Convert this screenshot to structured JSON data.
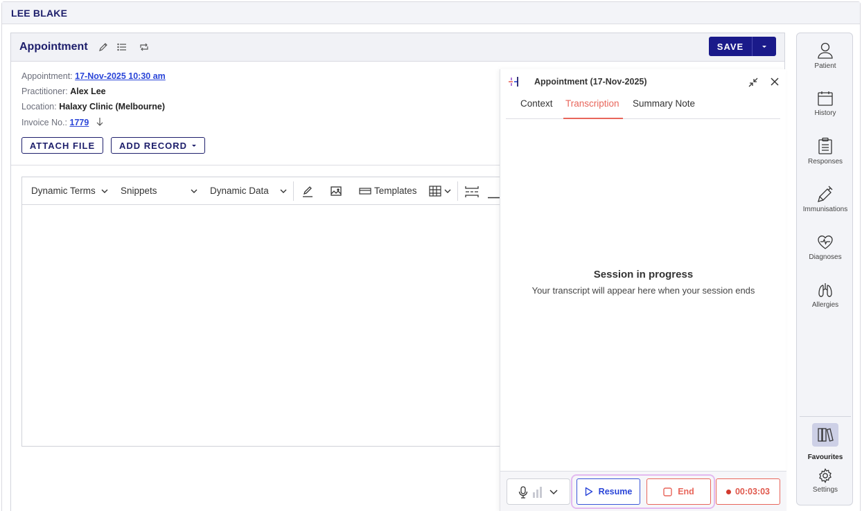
{
  "patient": {
    "name": "LEE BLAKE"
  },
  "card": {
    "title": "Appointment",
    "save_label": "SAVE"
  },
  "info": {
    "appointment_label": "Appointment:",
    "appointment_value": "17-Nov-2025 10:30 am",
    "practitioner_label": "Practitioner:",
    "practitioner_value": "Alex Lee",
    "location_label": "Location:",
    "location_value": "Halaxy Clinic (Melbourne)",
    "invoice_label": "Invoice No.:",
    "invoice_value": "1779"
  },
  "buttons": {
    "attach_file": "ATTACH FILE",
    "add_record": "ADD RECORD"
  },
  "toolbar": {
    "dynamic_terms": "Dynamic Terms",
    "snippets": "Snippets",
    "dynamic_data": "Dynamic Data",
    "templates": "Templates"
  },
  "side_panel": {
    "title": "Appointment (17-Nov-2025)",
    "tabs": [
      {
        "label": "Context"
      },
      {
        "label": "Transcription"
      },
      {
        "label": "Summary Note"
      }
    ],
    "active_tab": "Transcription",
    "session_title": "Session in progress",
    "session_subtitle": "Your transcript will appear here when your session ends",
    "resume_label": "Resume",
    "end_label": "End",
    "timer": "00:03:03"
  },
  "rail": {
    "items": [
      {
        "label": "Patient",
        "icon": "person-icon"
      },
      {
        "label": "History",
        "icon": "calendar-icon"
      },
      {
        "label": "Responses",
        "icon": "clipboard-icon"
      },
      {
        "label": "Immunisations",
        "icon": "syringe-icon"
      },
      {
        "label": "Diagnoses",
        "icon": "heart-pulse-icon"
      },
      {
        "label": "Allergies",
        "icon": "lungs-icon"
      }
    ],
    "favourites_label": "Favourites",
    "settings_label": "Settings"
  },
  "colors": {
    "brand_navy": "#1d1e6b",
    "save_bg": "#1a1a8a",
    "link_blue": "#2a45d8",
    "accent_red": "#e8655a",
    "highlight_purple": "#e3b9f0"
  }
}
